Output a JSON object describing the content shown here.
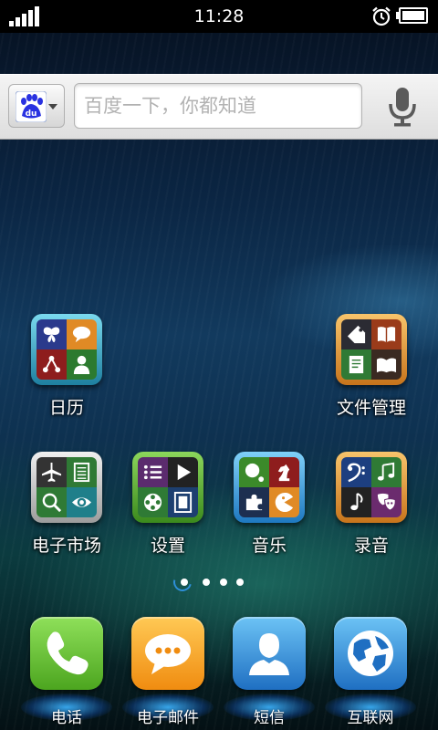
{
  "status_bar": {
    "time": "11:28",
    "icons": [
      "signal-icon",
      "alarm-icon",
      "battery-icon"
    ]
  },
  "search": {
    "placeholder": "百度一下，你都知道",
    "engine_icon": "baidu-logo",
    "engine_logo_text": "du",
    "mic_icon": "microphone-icon"
  },
  "workspace": {
    "apps": [
      {
        "label": "日历",
        "icons": [
          "butterfly-icon",
          "speech-bubble-icon",
          "share-icon",
          "person-icon"
        ]
      },
      {
        "label": "文件管理",
        "icons": [
          "tag-icon",
          "book-icon",
          "document-icon",
          "open-book-icon"
        ]
      },
      {
        "label": "电子市场",
        "icons": [
          "airplane-icon",
          "notes-icon",
          "search-icon",
          "eye-icon"
        ]
      },
      {
        "label": "设置",
        "icons": [
          "list-icon",
          "play-icon",
          "film-reel-icon",
          "film-strip-icon"
        ]
      },
      {
        "label": "音乐",
        "icons": [
          "chat-dots-icon",
          "chess-knight-icon",
          "puzzle-icon",
          "pacman-icon"
        ]
      },
      {
        "label": "录音",
        "icons": [
          "bass-clef-icon",
          "music-note-icon",
          "eighth-note-icon",
          "theater-masks-icon"
        ]
      }
    ],
    "page_indicator": {
      "pages": 4,
      "current": 1
    }
  },
  "dock": {
    "items": [
      {
        "label": "电话",
        "icon": "phone-icon"
      },
      {
        "label": "电子邮件",
        "icon": "chat-bubble-icon"
      },
      {
        "label": "短信",
        "icon": "contact-icon"
      },
      {
        "label": "互联网",
        "icon": "globe-icon"
      }
    ]
  },
  "colors": {
    "search_bar": "#e8e8e8",
    "indicator_accent": "#2d8fd8"
  }
}
